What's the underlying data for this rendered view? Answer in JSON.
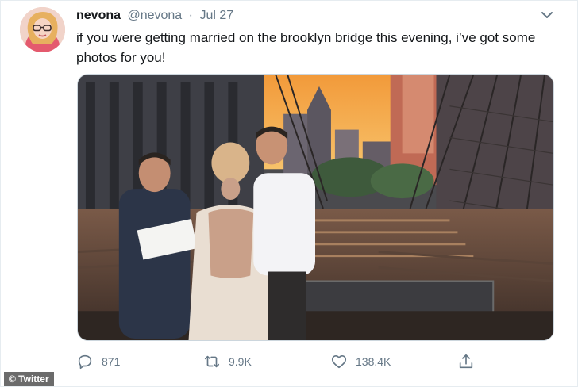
{
  "tweet": {
    "author_name": "nevona",
    "author_handle": "@nevona",
    "separator": "·",
    "date": "Jul 27",
    "text": "if you were getting married on the brooklyn bridge this evening, i’ve got some photos for you!"
  },
  "actions": {
    "reply_count": "871",
    "retweet_count": "9.9K",
    "like_count": "138.4K"
  },
  "icons": {
    "avatar": "avatar-image",
    "caret": "chevron-down-icon",
    "reply": "reply-icon",
    "retweet": "retweet-icon",
    "like": "heart-icon",
    "share": "share-icon"
  },
  "watermark": {
    "label": "© Twitter"
  },
  "colors": {
    "text": "#14171a",
    "secondary": "#657786",
    "border": "#e6ecf0"
  }
}
